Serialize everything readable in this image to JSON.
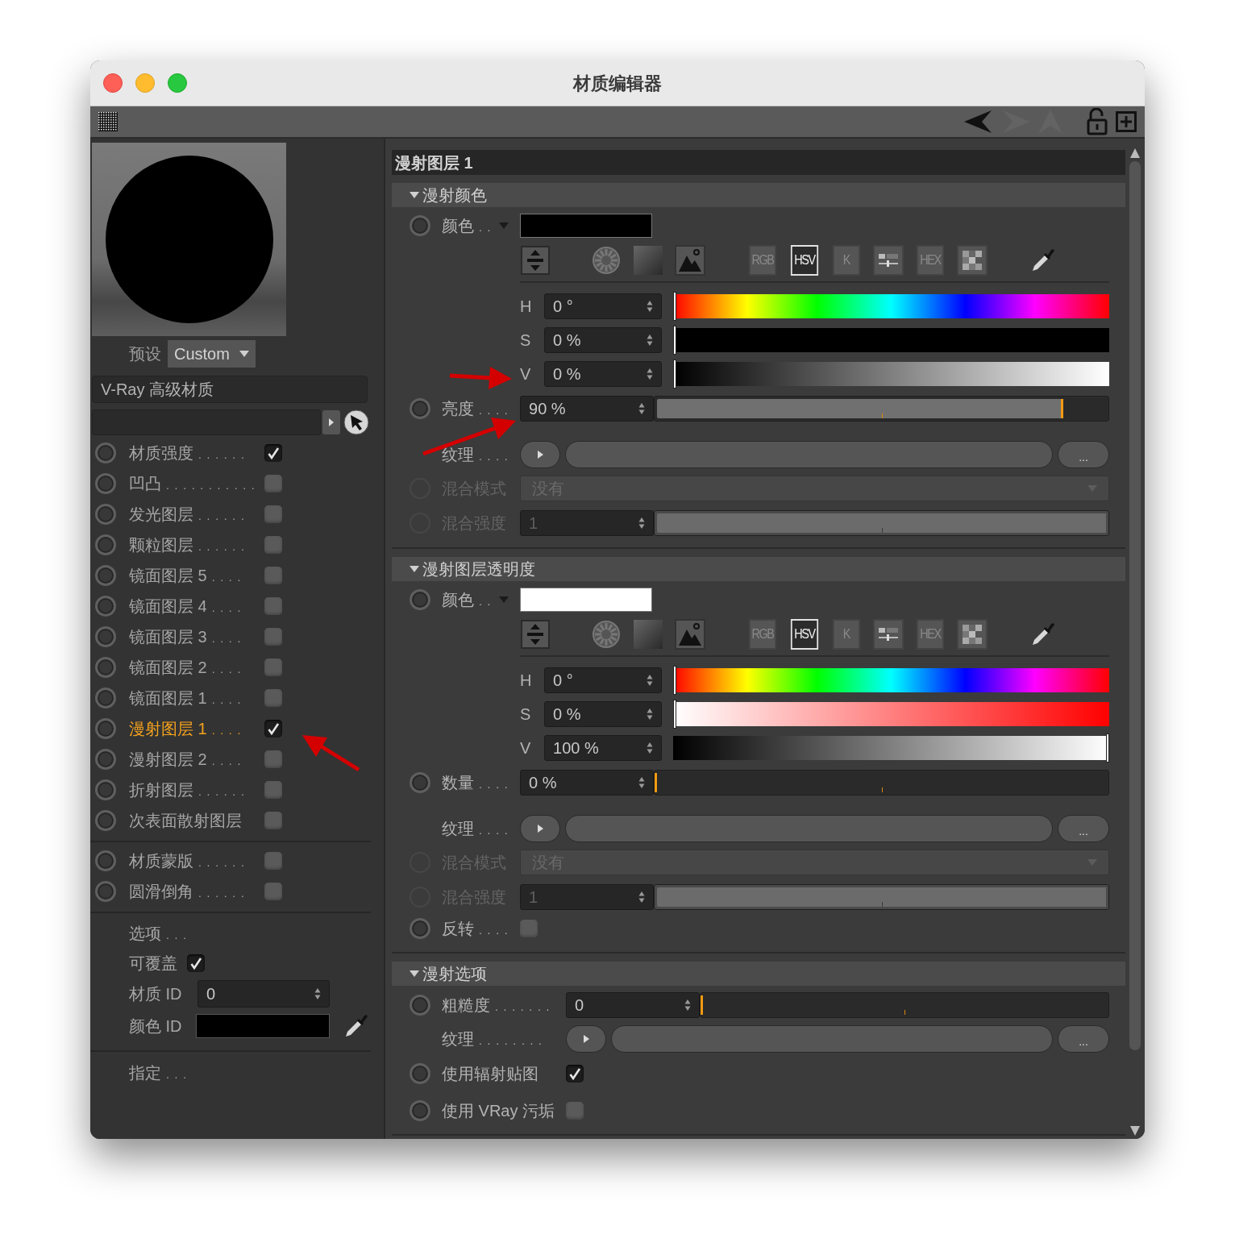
{
  "window": {
    "title": "材质编辑器"
  },
  "preview": {
    "preset_label": "预设",
    "preset_value": "Custom"
  },
  "material_name": "V-Ray 高级材质",
  "channels": [
    {
      "label": "材质强度",
      "leader": ". . . . . .",
      "checked": true,
      "selected": false
    },
    {
      "label": "凹凸",
      "leader": ". . . . . . . . . . .",
      "checked": false,
      "selected": false
    },
    {
      "label": "发光图层",
      "leader": ". . . . . .",
      "checked": false,
      "selected": false
    },
    {
      "label": "颗粒图层",
      "leader": ". . . . . .",
      "checked": false,
      "selected": false
    },
    {
      "label": "镜面图层 5",
      "leader": ". . . .",
      "checked": false,
      "selected": false
    },
    {
      "label": "镜面图层 4",
      "leader": ". . . .",
      "checked": false,
      "selected": false
    },
    {
      "label": "镜面图层 3",
      "leader": ". . . .",
      "checked": false,
      "selected": false
    },
    {
      "label": "镜面图层 2",
      "leader": ". . . .",
      "checked": false,
      "selected": false
    },
    {
      "label": "镜面图层 1",
      "leader": ". . . .",
      "checked": false,
      "selected": false
    },
    {
      "label": "漫射图层 1",
      "leader": ". . . .",
      "checked": true,
      "selected": true
    },
    {
      "label": "漫射图层 2",
      "leader": ". . . .",
      "checked": false,
      "selected": false
    },
    {
      "label": "折射图层",
      "leader": ". . . . . .",
      "checked": false,
      "selected": false
    },
    {
      "label": "次表面散射图层",
      "checked": false,
      "selected": false
    }
  ],
  "extra_channels": [
    {
      "label": "材质蒙版",
      "leader": ". . . . . .",
      "checked": false,
      "selected": false
    },
    {
      "label": "圆滑倒角",
      "leader": ". . . . . .",
      "checked": false,
      "selected": false
    }
  ],
  "options": {
    "title": "选项",
    "title_leader": ". . .",
    "overridable_label": "可覆盖",
    "overridable": true,
    "material_id_label": "材质 ID",
    "material_id": "0",
    "color_id_label": "颜色 ID",
    "color_id": {
      "color": "#000000"
    }
  },
  "assign": {
    "label": "指定",
    "leader": ". . ."
  },
  "panel_title": "漫射图层 1",
  "sections": [
    {
      "title": "漫射颜色",
      "expanded": true,
      "rows": [
        {
          "kind": "color",
          "label": "颜色",
          "leader": ". .",
          "color": "#000000",
          "modes": [
            {
              "kind": "text",
              "label": "RGB",
              "selected": false
            },
            {
              "kind": "text",
              "label": "HSV",
              "selected": true
            },
            {
              "kind": "text",
              "label": "K",
              "selected": false
            },
            {
              "kind": "sliders",
              "selected": false
            },
            {
              "kind": "text",
              "label": "HEX",
              "selected": false
            },
            {
              "kind": "swatches",
              "selected": false
            }
          ],
          "hsv": [
            {
              "label": "H",
              "value": "0 °",
              "level": 0
            },
            {
              "label": "S",
              "value": "0 %",
              "level": 0
            },
            {
              "label": "V",
              "value": "0 %",
              "level": 0
            }
          ]
        },
        {
          "kind": "slider",
          "label": "亮度",
          "leader": ". . . .",
          "value": "90 %",
          "level": 0.9,
          "disabled": false
        },
        {
          "kind": "texture",
          "label": "纹理",
          "leader": ". . . .",
          "more": "..."
        },
        {
          "kind": "dropdown",
          "label": "混合模式",
          "value": "没有",
          "disabled": true
        },
        {
          "kind": "slider",
          "label": "混合强度",
          "value": "1",
          "level": 1,
          "disabled": true
        }
      ]
    },
    {
      "title": "漫射图层透明度",
      "expanded": true,
      "rows": [
        {
          "kind": "color",
          "label": "颜色",
          "leader": ". .",
          "color": "#ffffff",
          "modes": [
            {
              "kind": "text",
              "label": "RGB",
              "selected": false
            },
            {
              "kind": "text",
              "label": "HSV",
              "selected": true
            },
            {
              "kind": "text",
              "label": "K",
              "selected": false
            },
            {
              "kind": "sliders",
              "selected": false
            },
            {
              "kind": "text",
              "label": "HEX",
              "selected": false
            },
            {
              "kind": "swatches",
              "selected": false
            }
          ],
          "hsv": [
            {
              "label": "H",
              "value": "0 °",
              "level": 0
            },
            {
              "label": "S",
              "value": "0 %",
              "level": 0
            },
            {
              "label": "V",
              "value": "100 %",
              "level": 1
            }
          ]
        },
        {
          "kind": "slider",
          "label": "数量",
          "leader": ". . . .",
          "value": "0 %",
          "level": 0,
          "disabled": false
        },
        {
          "kind": "texture",
          "label": "纹理",
          "leader": ". . . .",
          "more": "..."
        },
        {
          "kind": "dropdown",
          "label": "混合模式",
          "value": "没有",
          "disabled": true
        },
        {
          "kind": "slider",
          "label": "混合强度",
          "value": "1",
          "level": 1,
          "disabled": true
        },
        {
          "kind": "checkbox",
          "label": "反转",
          "leader": ". . . .",
          "checked": false
        }
      ]
    },
    {
      "title": "漫射选项",
      "expanded": true,
      "rows": [
        {
          "kind": "slider",
          "label": "粗糙度",
          "leader": ". . . . . . .",
          "value": "0",
          "level": 0,
          "disabled": false
        },
        {
          "kind": "texture",
          "label": "纹理",
          "leader": ". . . . . . . .",
          "more": "..."
        },
        {
          "kind": "checkbox",
          "label": "使用辐射贴图",
          "checked": true
        },
        {
          "kind": "checkbox",
          "label": "使用 VRay 污垢",
          "checked": false
        }
      ]
    }
  ]
}
